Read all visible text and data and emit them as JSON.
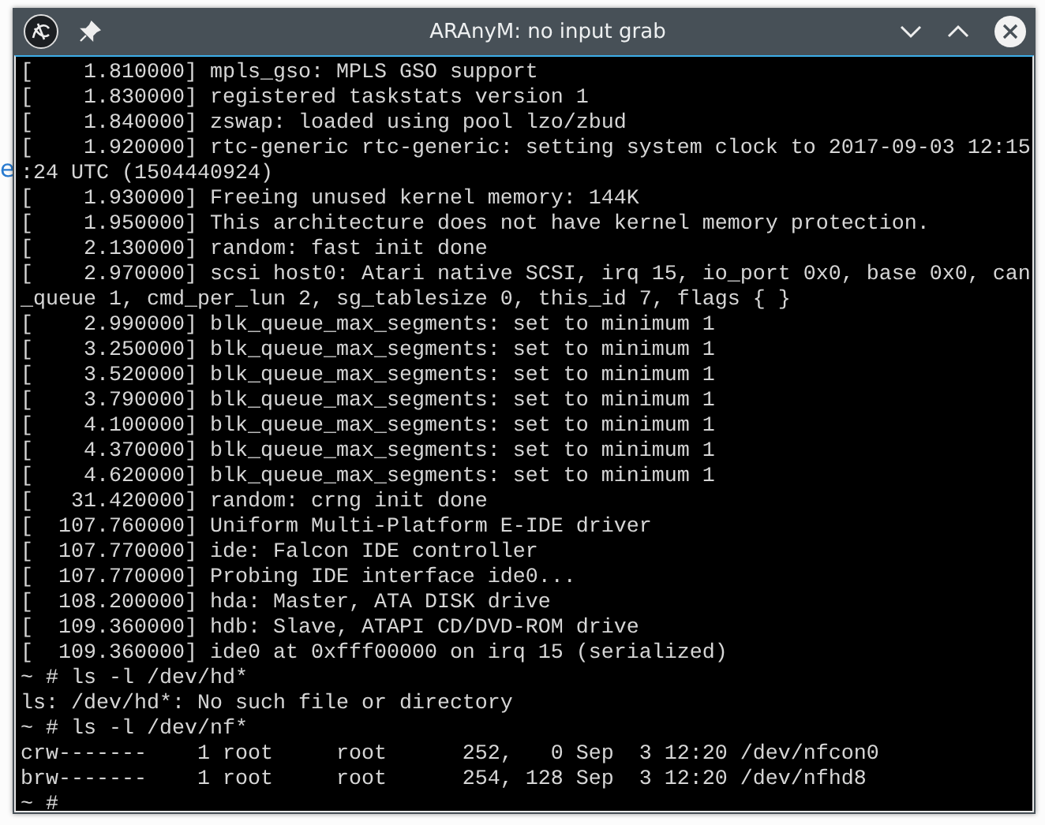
{
  "background_fragment": "e",
  "window": {
    "title": "ARAnyM: no input grab"
  },
  "terminal": {
    "lines": [
      "[    1.810000] mpls_gso: MPLS GSO support",
      "[    1.830000] registered taskstats version 1",
      "[    1.840000] zswap: loaded using pool lzo/zbud",
      "[    1.920000] rtc-generic rtc-generic: setting system clock to 2017-09-03 12:15",
      ":24 UTC (1504440924)",
      "[    1.930000] Freeing unused kernel memory: 144K",
      "[    1.950000] This architecture does not have kernel memory protection.",
      "[    2.130000] random: fast init done",
      "[    2.970000] scsi host0: Atari native SCSI, irq 15, io_port 0x0, base 0x0, can",
      "_queue 1, cmd_per_lun 2, sg_tablesize 0, this_id 7, flags { }",
      "[    2.990000] blk_queue_max_segments: set to minimum 1",
      "[    3.250000] blk_queue_max_segments: set to minimum 1",
      "[    3.520000] blk_queue_max_segments: set to minimum 1",
      "[    3.790000] blk_queue_max_segments: set to minimum 1",
      "[    4.100000] blk_queue_max_segments: set to minimum 1",
      "[    4.370000] blk_queue_max_segments: set to minimum 1",
      "[    4.620000] blk_queue_max_segments: set to minimum 1",
      "[   31.420000] random: crng init done",
      "[  107.760000] Uniform Multi-Platform E-IDE driver",
      "[  107.770000] ide: Falcon IDE controller",
      "[  107.770000] Probing IDE interface ide0...",
      "[  108.200000] hda: Master, ATA DISK drive",
      "[  109.360000] hdb: Slave, ATAPI CD/DVD-ROM drive",
      "[  109.360000] ide0 at 0xfff00000 on irq 15 (serialized)",
      "~ # ls -l /dev/hd*",
      "ls: /dev/hd*: No such file or directory",
      "~ # ls -l /dev/nf*",
      "crw-------    1 root     root      252,   0 Sep  3 12:20 /dev/nfcon0",
      "brw-------    1 root     root      254, 128 Sep  3 12:20 /dev/nfhd8",
      "~ #"
    ]
  }
}
